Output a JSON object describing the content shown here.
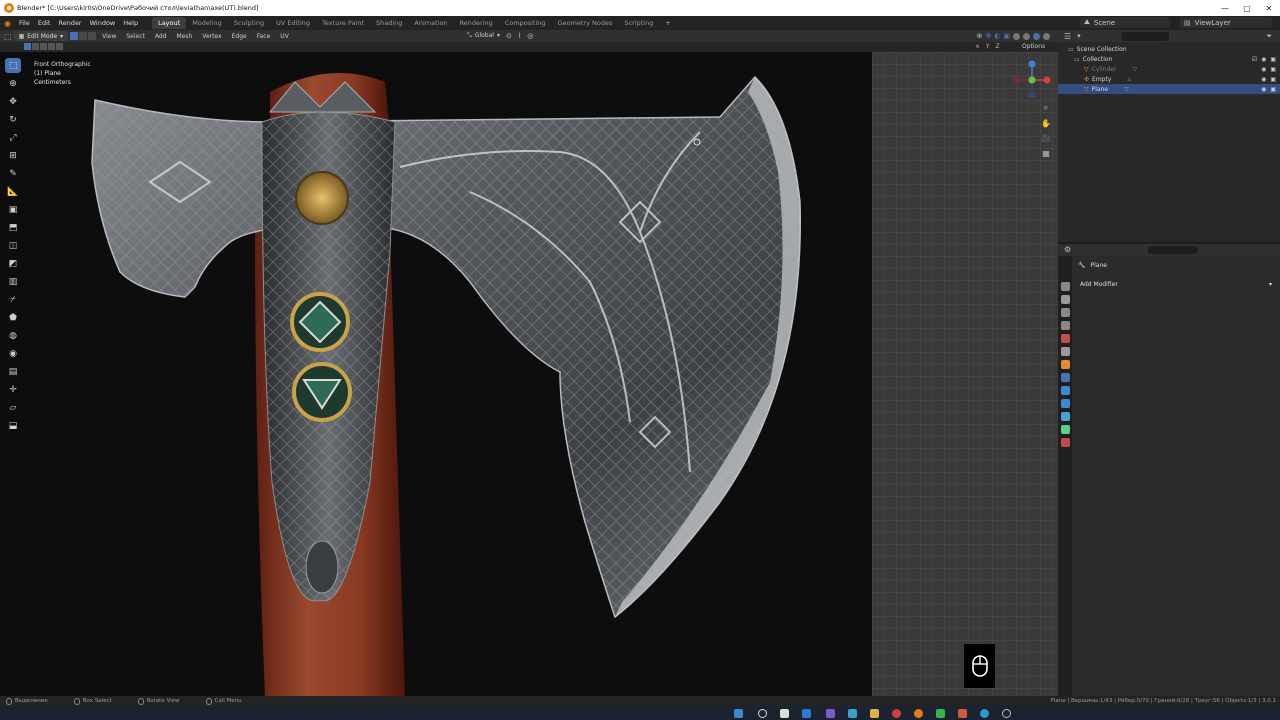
{
  "window": {
    "title": "Blender* [C:\\Users\\kir0s\\OneDrive\\Рабочий стол\\leviathan\\axe(UT).blend]",
    "controls": [
      "—",
      "▢",
      "✕"
    ]
  },
  "menu": [
    "File",
    "Edit",
    "Render",
    "Window",
    "Help"
  ],
  "workspaces": [
    "Layout",
    "Modeling",
    "Sculpting",
    "UV Editing",
    "Texture Paint",
    "Shading",
    "Animation",
    "Rendering",
    "Compositing",
    "Geometry Nodes",
    "Scripting"
  ],
  "workspace_add": "+",
  "scene": {
    "label": "Scene"
  },
  "view_layer": {
    "label": "ViewLayer"
  },
  "viewport_header": {
    "mode": "Edit Mode",
    "menus": [
      "View",
      "Select",
      "Add",
      "Mesh",
      "Vertex",
      "Edge",
      "Face",
      "UV"
    ],
    "orientation": "Global",
    "options": "Options"
  },
  "viewport_info": {
    "line1": "Front Orthographic",
    "line2": "(1) Plane",
    "line3": "Centimeters"
  },
  "toolbar_icons": [
    "select-box-icon",
    "cursor-icon",
    "move-icon",
    "rotate-icon",
    "scale-icon",
    "transform-icon",
    "annotate-icon",
    "measure-icon",
    "add-cube-icon",
    "extrude-icon",
    "inset-icon",
    "bevel-icon",
    "loop-cut-icon",
    "knife-icon",
    "poly-build-icon",
    "spin-icon",
    "smooth-icon",
    "edge-slide-icon",
    "shrink-fatten-icon",
    "shear-icon",
    "rip-icon"
  ],
  "outliner": {
    "root": "Scene Collection",
    "collection": "Collection",
    "items": [
      {
        "name": "Cylinder",
        "selected": false,
        "dim": true
      },
      {
        "name": "Empty",
        "selected": false,
        "dim": false
      },
      {
        "name": "Plane",
        "selected": true,
        "dim": false
      }
    ]
  },
  "properties": {
    "object_name": "Plane",
    "add_modifier": "Add Modifier"
  },
  "statusbar": {
    "items": [
      "Выделение",
      "Box Select",
      "Rotate View",
      "Call Menu"
    ],
    "stats": "Plane | Вершины:1/43 | Рёбер:0/70 | Граней:0/28 | Треуг:56 | Objects:1/3 | 3.0.1"
  },
  "colors": {
    "accent": "#4772b3",
    "selection": "#334d80",
    "handle_wood": "#8b3a22",
    "blade": "#6a6e72"
  }
}
